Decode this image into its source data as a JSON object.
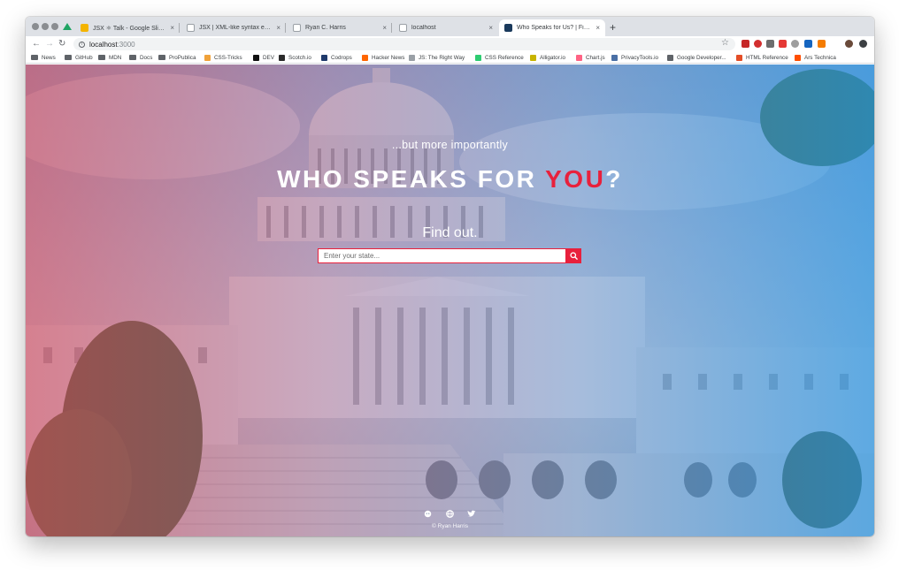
{
  "browser": {
    "tabs": [
      {
        "title": "JSX ⚛ Talk - Google Slides",
        "favicon_color": "#f4b400"
      },
      {
        "title": "JSX | XML-like syntax extension",
        "favicon_color": "#9aa0a6"
      },
      {
        "title": "Ryan C. Harris",
        "favicon_color": "#9aa0a6"
      },
      {
        "title": "localhost",
        "favicon_color": "#9aa0a6"
      },
      {
        "title": "Who Speaks for Us? | Find Out",
        "favicon_color": "#1a3a5c",
        "active": true
      }
    ],
    "tab_close": "×",
    "new_tab": "+",
    "url": {
      "host": "localhost",
      "port": ":3000"
    },
    "nav": {
      "back": "←",
      "forward": "→",
      "reload": "↻"
    },
    "star": "☆",
    "bookmarks": [
      {
        "label": "News",
        "kind": "folder"
      },
      {
        "label": "GitHub",
        "kind": "folder"
      },
      {
        "label": "MDN",
        "kind": "folder"
      },
      {
        "label": "Docs",
        "kind": "folder"
      },
      {
        "label": "ProPublica",
        "kind": "folder"
      },
      {
        "label": "CSS-Tricks",
        "kind": "site",
        "color": "#f0a23a"
      },
      {
        "label": "DEV",
        "kind": "site",
        "color": "#111111"
      },
      {
        "label": "Scotch.io",
        "kind": "site",
        "color": "#2b2b2b"
      },
      {
        "label": "Codrops",
        "kind": "site",
        "color": "#1f3a6b"
      },
      {
        "label": "Hacker News",
        "kind": "site",
        "color": "#ff6600"
      },
      {
        "label": "JS: The Right Way",
        "kind": "site",
        "color": "#9aa0a6"
      },
      {
        "label": "CSS Reference",
        "kind": "site",
        "color": "#2ecc71"
      },
      {
        "label": "Alligator.io",
        "kind": "site",
        "color": "#c8b400"
      },
      {
        "label": "Chart.js",
        "kind": "site",
        "color": "#ff6384"
      },
      {
        "label": "PrivacyTools.io",
        "kind": "site",
        "color": "#4a6fa5"
      },
      {
        "label": "Google Developer...",
        "kind": "site",
        "color": "#5f6368"
      },
      {
        "label": "HTML Reference",
        "kind": "site",
        "color": "#e44d26"
      },
      {
        "label": "Ars Technica",
        "kind": "site",
        "color": "#ff4e00"
      }
    ]
  },
  "hero": {
    "subtitle": "...but more importantly",
    "headline_prefix": "WHO SPEAKS FOR ",
    "headline_emphasis": "YOU",
    "headline_suffix": "?",
    "cta": "Find out.",
    "search_placeholder": "Enter your state..."
  },
  "footer": {
    "credit": "© Ryan Harris",
    "icons": [
      "github-icon",
      "globe-icon",
      "twitter-icon"
    ]
  },
  "colors": {
    "accent": "#e8203c"
  }
}
